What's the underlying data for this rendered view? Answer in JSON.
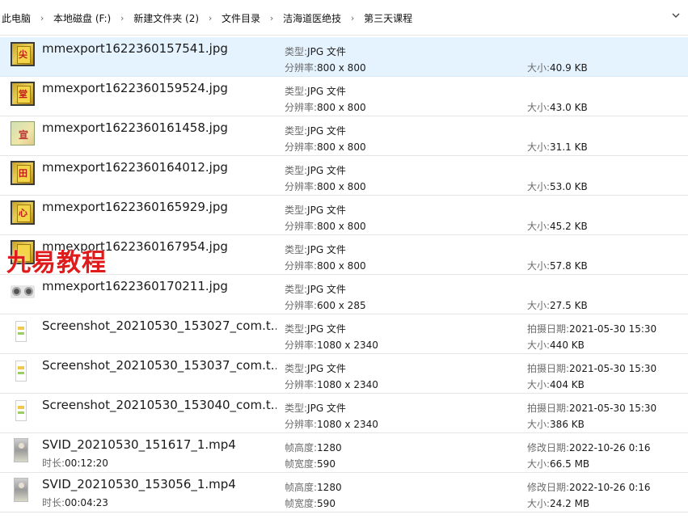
{
  "breadcrumb": {
    "items": [
      "此电脑",
      "本地磁盘 (F:)",
      "新建文件夹 (2)",
      "文件目录",
      "洁海道医绝技",
      "第三天课程"
    ],
    "separator": "›",
    "dropdown_icon": "chevron-down-icon"
  },
  "labels": {
    "type": "类型:",
    "resolution": "分辨率:",
    "size": "大小:",
    "date_taken": "拍摄日期:",
    "date_modified": "修改日期:",
    "frame_height": "帧高度:",
    "frame_width": "帧宽度:",
    "duration": "时长:"
  },
  "files": [
    {
      "name": "mmexport1622360157541.jpg",
      "type": "JPG 文件",
      "resolution": "800 x 800",
      "size": "40.9 KB",
      "thumb": "gold",
      "glyph": "尖",
      "selected": true
    },
    {
      "name": "mmexport1622360159524.jpg",
      "type": "JPG 文件",
      "resolution": "800 x 800",
      "size": "43.0 KB",
      "thumb": "gold",
      "glyph": "堂"
    },
    {
      "name": "mmexport1622360161458.jpg",
      "type": "JPG 文件",
      "resolution": "800 x 800",
      "size": "31.1 KB",
      "thumb": "green",
      "glyph": "宣"
    },
    {
      "name": "mmexport1622360164012.jpg",
      "type": "JPG 文件",
      "resolution": "800 x 800",
      "size": "53.0 KB",
      "thumb": "gold",
      "glyph": "田"
    },
    {
      "name": "mmexport1622360165929.jpg",
      "type": "JPG 文件",
      "resolution": "800 x 800",
      "size": "45.2 KB",
      "thumb": "gold",
      "glyph": "心"
    },
    {
      "name": "mmexport1622360167954.jpg",
      "type": "JPG 文件",
      "resolution": "800 x 800",
      "size": "57.8 KB",
      "thumb": "gold",
      "glyph": ""
    },
    {
      "name": "mmexport1622360170211.jpg",
      "type": "JPG 文件",
      "resolution": "600 x 285",
      "size": "27.5 KB",
      "thumb": "eyes"
    },
    {
      "name": "Screenshot_20210530_153027_com.t...",
      "type": "JPG 文件",
      "resolution": "1080 x 2340",
      "date": "2021-05-30 15:30",
      "size": "440 KB",
      "thumb": "phone"
    },
    {
      "name": "Screenshot_20210530_153037_com.t...",
      "type": "JPG 文件",
      "resolution": "1080 x 2340",
      "date": "2021-05-30 15:30",
      "size": "404 KB",
      "thumb": "phone"
    },
    {
      "name": "Screenshot_20210530_153040_com.t...",
      "type": "JPG 文件",
      "resolution": "1080 x 2340",
      "date": "2021-05-30 15:30",
      "size": "386 KB",
      "thumb": "phone"
    }
  ],
  "videos": [
    {
      "name": "SVID_20210530_151617_1.mp4",
      "duration": "00:12:20",
      "frame_height": "1280",
      "frame_width": "590",
      "modified": "2022-10-26 0:16",
      "size": "66.5 MB"
    },
    {
      "name": "SVID_20210530_153056_1.mp4",
      "duration": "00:04:23",
      "frame_height": "1280",
      "frame_width": "590",
      "modified": "2022-10-26 0:16",
      "size": "24.2 MB"
    }
  ],
  "watermark": "九易教程",
  "colors": {
    "selected_row": "#e5f3ff",
    "watermark": "#e01b1b",
    "label_gray": "#6b6b6b"
  }
}
